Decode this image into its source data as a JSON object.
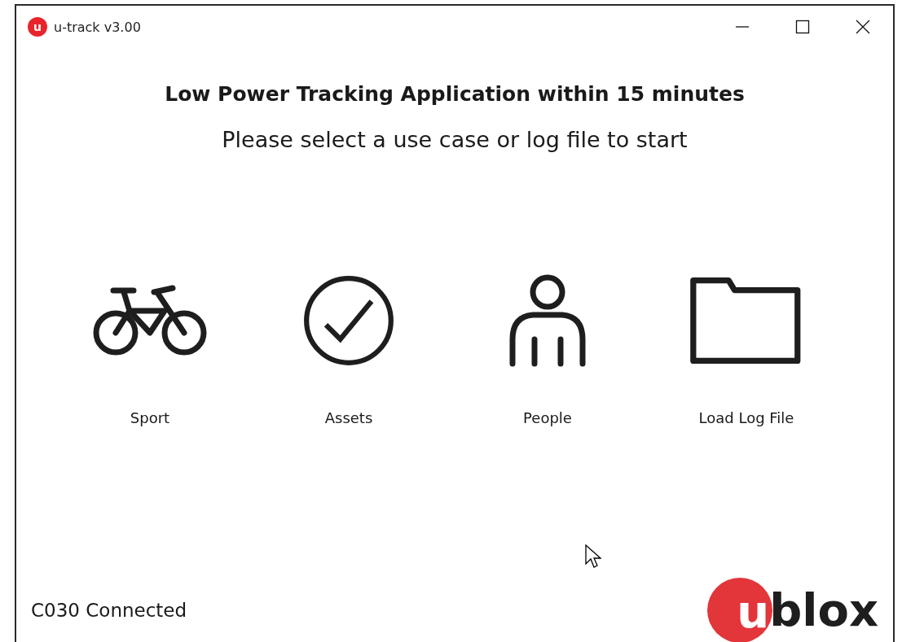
{
  "window": {
    "title": "u-track v3.00",
    "app_icon_letter": "u"
  },
  "heading": "Low Power Tracking Application within 15 minutes",
  "subheading": "Please select a use case or log file to start",
  "use_cases": [
    {
      "kind": "bicycle",
      "label": "Sport"
    },
    {
      "kind": "check",
      "label": "Assets"
    },
    {
      "kind": "person",
      "label": "People"
    },
    {
      "kind": "folder",
      "label": "Load Log File"
    }
  ],
  "status": "C030 Connected",
  "logo": {
    "mark": "u",
    "text": "blox"
  }
}
